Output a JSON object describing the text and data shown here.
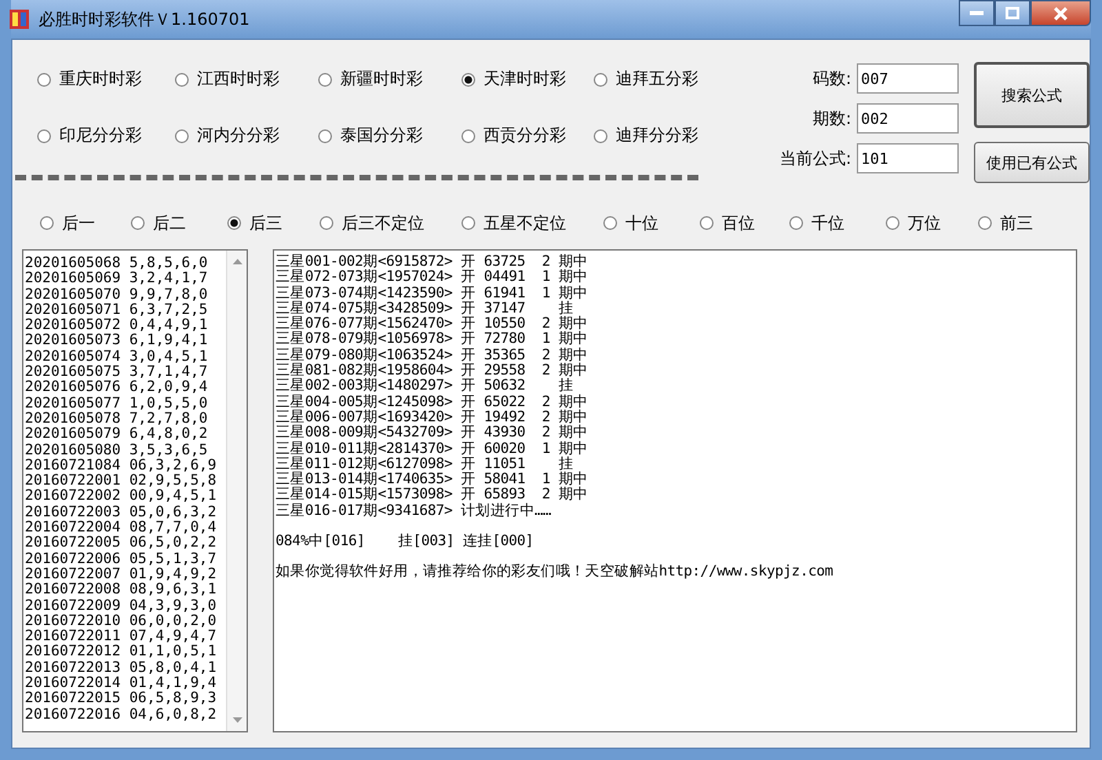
{
  "window": {
    "title": "必胜时时彩软件Ｖ1.160701"
  },
  "lotteries": [
    {
      "label": "重庆时时彩",
      "selected": false
    },
    {
      "label": "江西时时彩",
      "selected": false
    },
    {
      "label": "新疆时时彩",
      "selected": false
    },
    {
      "label": "天津时时彩",
      "selected": true
    },
    {
      "label": "迪拜五分彩",
      "selected": false
    },
    {
      "label": "印尼分分彩",
      "selected": false
    },
    {
      "label": "河内分分彩",
      "selected": false
    },
    {
      "label": "泰国分分彩",
      "selected": false
    },
    {
      "label": "西贡分分彩",
      "selected": false
    },
    {
      "label": "迪拜分分彩",
      "selected": false
    }
  ],
  "fields": [
    {
      "label": "码数:",
      "value": "007"
    },
    {
      "label": "期数:",
      "value": "002"
    },
    {
      "label": "当前公式:",
      "value": "101"
    }
  ],
  "buttons": [
    "搜索公式",
    "使用已有公式"
  ],
  "positions": [
    {
      "label": "后一",
      "selected": false
    },
    {
      "label": "后二",
      "selected": false
    },
    {
      "label": "后三",
      "selected": true
    },
    {
      "label": "后三不定位",
      "selected": false
    },
    {
      "label": "五星不定位",
      "selected": false
    },
    {
      "label": "十位",
      "selected": false
    },
    {
      "label": "百位",
      "selected": false
    },
    {
      "label": "千位",
      "selected": false
    },
    {
      "label": "万位",
      "selected": false
    },
    {
      "label": "前三",
      "selected": false
    }
  ],
  "draws": [
    "20201605068 5,8,5,6,0",
    "20201605069 3,2,4,1,7",
    "20201605070 9,9,7,8,0",
    "20201605071 6,3,7,2,5",
    "20201605072 0,4,4,9,1",
    "20201605073 6,1,9,4,1",
    "20201605074 3,0,4,5,1",
    "20201605075 3,7,1,4,7",
    "20201605076 6,2,0,9,4",
    "20201605077 1,0,5,5,0",
    "20201605078 7,2,7,8,0",
    "20201605079 6,4,8,0,2",
    "20201605080 3,5,3,6,5",
    "20160721084 06,3,2,6,9",
    "20160722001 02,9,5,5,8",
    "20160722002 00,9,4,5,1",
    "20160722003 05,0,6,3,2",
    "20160722004 08,7,7,0,4",
    "20160722005 06,5,0,2,2",
    "20160722006 05,5,1,3,7",
    "20160722007 01,9,4,9,2",
    "20160722008 08,9,6,3,1",
    "20160722009 04,3,9,3,0",
    "20160722010 06,0,0,2,0",
    "20160722011 07,4,9,4,7",
    "20160722012 01,1,0,5,1",
    "20160722013 05,8,0,4,1",
    "20160722014 01,4,1,9,4",
    "20160722015 06,5,8,9,3",
    "20160722016 04,6,0,8,2"
  ],
  "results": [
    "三星001-002期<6915872> 开 63725  2 期中",
    "三星072-073期<1957024> 开 04491  1 期中",
    "三星073-074期<1423590> 开 61941  1 期中",
    "三星074-075期<3428509> 开 37147    挂",
    "三星076-077期<1562470> 开 10550  2 期中",
    "三星078-079期<1056978> 开 72780  1 期中",
    "三星079-080期<1063524> 开 35365  2 期中",
    "三星081-082期<1958604> 开 29558  2 期中",
    "三星002-003期<1480297> 开 50632    挂",
    "三星004-005期<1245098> 开 65022  2 期中",
    "三星006-007期<1693420> 开 19492  2 期中",
    "三星008-009期<5432709> 开 43930  2 期中",
    "三星010-011期<2814370> 开 60020  1 期中",
    "三星011-012期<6127098> 开 11051    挂",
    "三星013-014期<1740635> 开 58041  1 期中",
    "三星014-015期<1573098> 开 65893  2 期中",
    "三星016-017期<9341687> 计划进行中……"
  ],
  "summary": "084%中[016]    挂[003] 连挂[000]",
  "message": "如果你觉得软件好用，请推荐给你的彩友们哦！天空破解站http://www.skypjz.com"
}
